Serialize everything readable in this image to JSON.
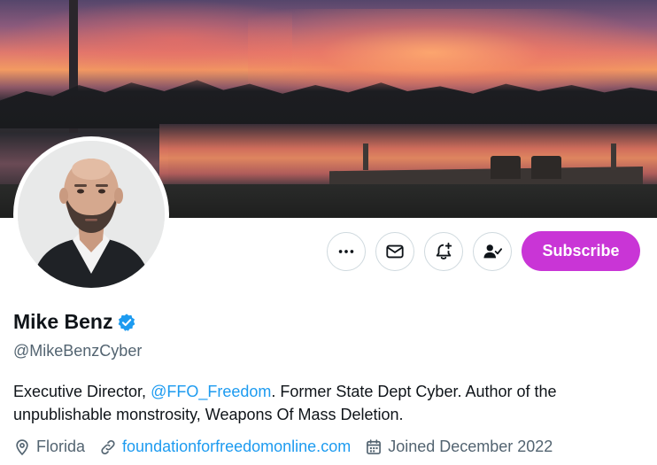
{
  "profile": {
    "name": "Mike Benz",
    "handle": "@MikeBenzCyber",
    "bio": {
      "before": "Executive Director, ",
      "mention": "@FFO_Freedom",
      "after": ". Former State Dept Cyber. Author of the unpublishable monstrosity, Weapons Of Mass Deletion."
    },
    "location": "Florida",
    "website": "foundationforfreedomonline.com",
    "joined": "Joined December 2022"
  },
  "actions": {
    "more_icon": "ellipsis-icon",
    "message_icon": "envelope-icon",
    "notify_icon": "bell-plus-icon",
    "following_icon": "person-check-icon",
    "subscribe_label": "Subscribe"
  },
  "colors": {
    "subscribe": "#c935d6",
    "link": "#1d9bf0",
    "verified": "#1d9bf0",
    "secondary_text": "#536471"
  }
}
